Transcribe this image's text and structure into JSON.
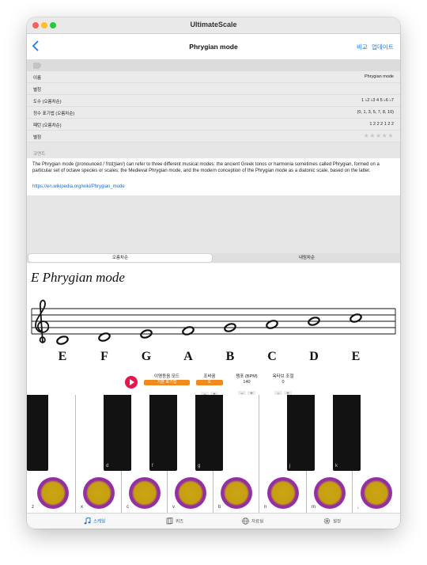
{
  "window": {
    "title": "UltimateScale"
  },
  "nav": {
    "back_icon": "chevron-left-icon",
    "title": "Phrygian mode",
    "compare": "비교",
    "update": "업데이트"
  },
  "info": {
    "section_title": "정보",
    "rows": [
      {
        "key": "이름",
        "value": "Phrygian mode"
      },
      {
        "key": "별칭",
        "value": ""
      },
      {
        "key": "도수 (오름차순)",
        "value": "1 ♭2 ♭3 4 5 ♭6 ♭7"
      },
      {
        "key": "정수 표기법 (오름차순)",
        "value": "(0, 1, 3, 5, 7, 8, 10)"
      },
      {
        "key": "패턴 (오름차순)",
        "value": "1 2 2 2 1 2 2"
      },
      {
        "key": "별점",
        "value": "★★★★★",
        "rating": 0
      }
    ],
    "comment_title": "코멘트",
    "comment": "The Phrygian mode (pronounced /ˈfrɪdʒiən/) can refer to three different musical modes: the ancient Greek tonos or harmonia sometimes called Phrygian, formed on a particular set of octave species or scales; the Medieval Phrygian mode, and the modern conception of the Phrygian mode as a diatonic scale, based on the latter.",
    "link": "https://en.wikipedia.org/wiki/Phrygian_mode"
  },
  "segment": {
    "ascending": "오름차순",
    "descending": "내림차순",
    "selected": "ascending"
  },
  "score": {
    "title": "E Phrygian mode",
    "notes": [
      "E",
      "F",
      "G",
      "A",
      "B",
      "C",
      "D",
      "E"
    ]
  },
  "controls": {
    "play_icon": "play-icon",
    "mode_label": "이명동음 모드",
    "mode_value": "기본 표기법",
    "transpose_label": "조바꿈",
    "transpose_value": "E",
    "tempo_label": "템포 (BPM)",
    "tempo_value": "140",
    "octave_label": "옥타브 조절",
    "octave_value": "0",
    "minus": "−",
    "plus": "+"
  },
  "keyboard": {
    "black_keys": [
      "",
      "d",
      "f",
      "g",
      "j",
      "k"
    ],
    "white_keys": [
      "z",
      "x",
      "c",
      "v",
      "b",
      "n",
      "m",
      ","
    ],
    "pad_color_outer": "#c22dc0",
    "pad_color_inner": "#c9a514"
  },
  "tabs": [
    {
      "label": "스케일",
      "icon": "music-notes-icon"
    },
    {
      "label": "퀴즈",
      "icon": "cards-icon"
    },
    {
      "label": "자료실",
      "icon": "globe-icon"
    },
    {
      "label": "설정",
      "icon": "gear-icon"
    }
  ],
  "colors": {
    "accent": "#1a7cf5",
    "play": "#e8174b",
    "pill": "#f08a1c"
  }
}
